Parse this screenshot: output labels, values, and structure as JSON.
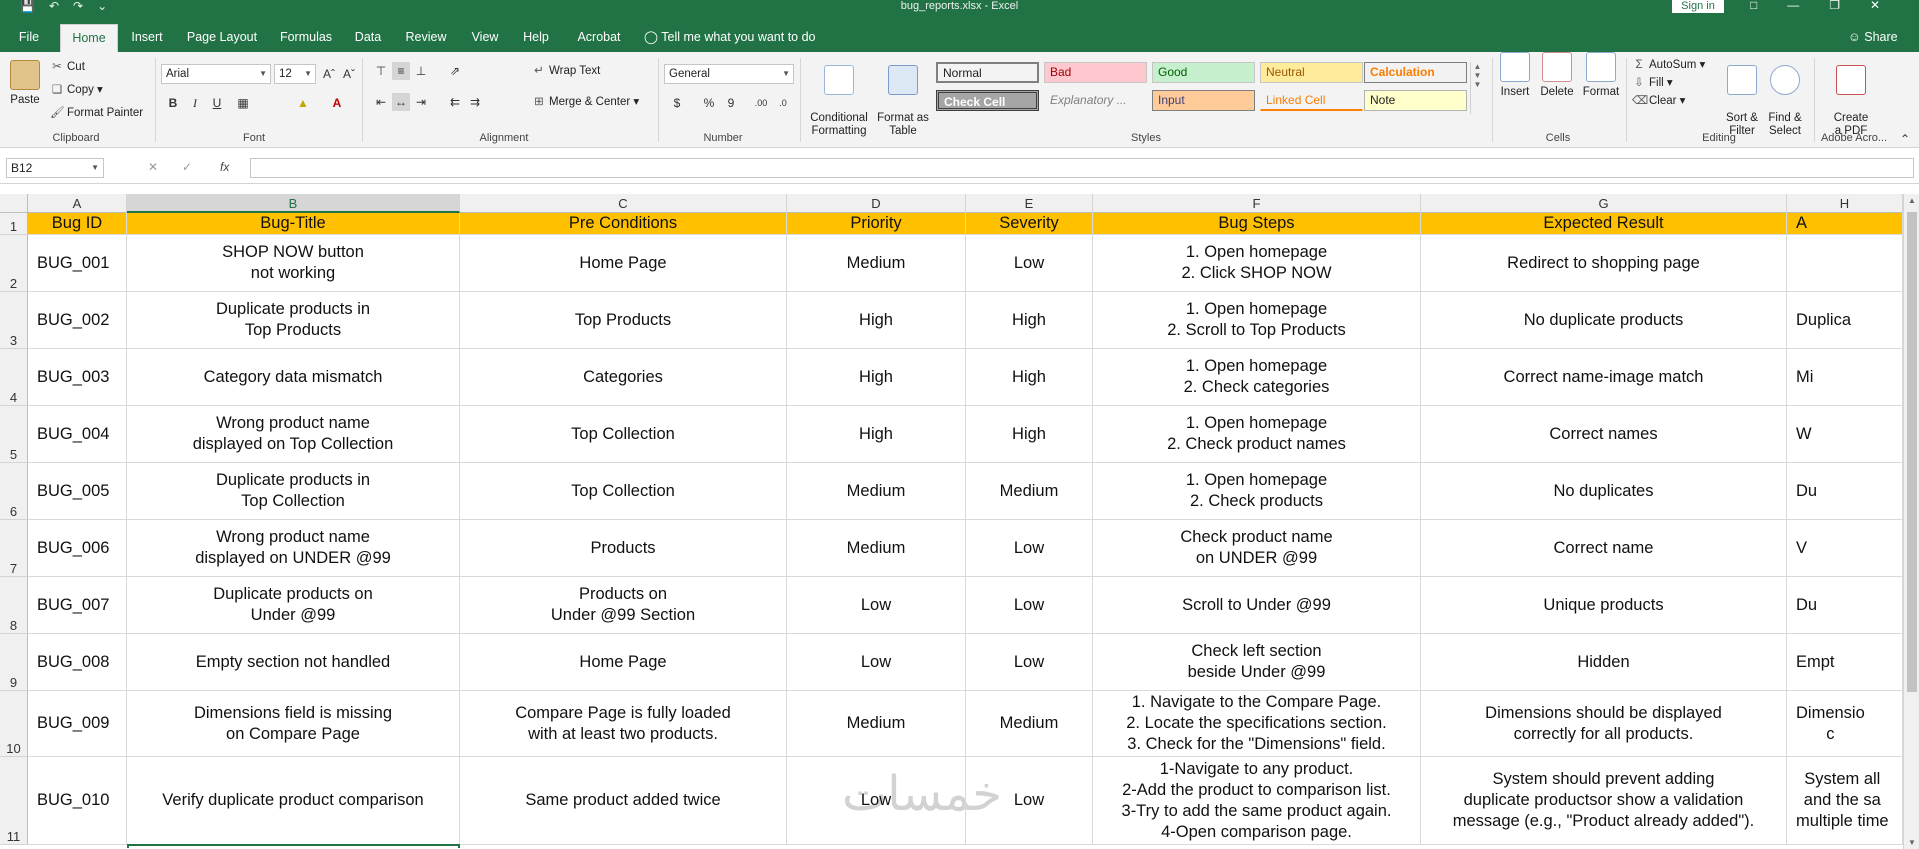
{
  "window": {
    "title": "bug_reports.xlsx  -  Excel",
    "sign_in": "Sign in"
  },
  "tabs": [
    {
      "label": "File"
    },
    {
      "label": "Home"
    },
    {
      "label": "Insert"
    },
    {
      "label": "Page Layout"
    },
    {
      "label": "Formulas"
    },
    {
      "label": "Data"
    },
    {
      "label": "Review"
    },
    {
      "label": "View"
    },
    {
      "label": "Help"
    },
    {
      "label": "Acrobat"
    }
  ],
  "tell_me": "Tell me what you want to do",
  "share": "Share",
  "ribbon": {
    "clipboard": {
      "label": "Clipboard",
      "paste": "Paste",
      "cut": "Cut",
      "copy": "Copy",
      "format_painter": "Format Painter"
    },
    "font": {
      "label": "Font",
      "name": "Arial",
      "size": "12",
      "bold": "B",
      "italic": "I",
      "underline": "U"
    },
    "alignment": {
      "label": "Alignment",
      "wrap": "Wrap Text",
      "merge": "Merge & Center"
    },
    "number": {
      "label": "Number",
      "format": "General",
      "currency": "$",
      "percent": "%",
      "comma": "9"
    },
    "styles": {
      "label": "Styles",
      "conditional": "Conditional\nFormatting",
      "format_table": "Format as\nTable",
      "items": [
        {
          "name": "Normal",
          "bg": "#ffffff",
          "fg": "#000000"
        },
        {
          "name": "Bad",
          "bg": "#ffc7ce",
          "fg": "#9c0006"
        },
        {
          "name": "Good",
          "bg": "#c6efce",
          "fg": "#006100"
        },
        {
          "name": "Neutral",
          "bg": "#ffeb9c",
          "fg": "#9c5700"
        },
        {
          "name": "Calculation",
          "bg": "#f2f2f2",
          "fg": "#fa7d00"
        },
        {
          "name": "Check Cell",
          "bg": "#a5a5a5",
          "fg": "#ffffff"
        },
        {
          "name": "Explanatory ...",
          "bg": "#ffffff",
          "fg": "#7f7f7f"
        },
        {
          "name": "Input",
          "bg": "#ffcc99",
          "fg": "#3f3f76"
        },
        {
          "name": "Linked Cell",
          "bg": "#ffffff",
          "fg": "#fa7d00"
        },
        {
          "name": "Note",
          "bg": "#ffffcc",
          "fg": "#000000"
        }
      ]
    },
    "cells": {
      "label": "Cells",
      "insert": "Insert",
      "delete": "Delete",
      "format": "Format"
    },
    "editing": {
      "label": "Editing",
      "autosum": "AutoSum",
      "fill": "Fill",
      "clear": "Clear",
      "sort": "Sort &\nFilter",
      "find": "Find &\nSelect"
    },
    "acrobat": {
      "label": "Adobe Acro...",
      "create": "Create\na PDF"
    }
  },
  "formula_bar": {
    "name_box": "B12",
    "value": ""
  },
  "columns": [
    "A",
    "B",
    "C",
    "D",
    "E",
    "F",
    "G",
    "H"
  ],
  "selected_column": "B",
  "rows": [
    "1",
    "2",
    "3",
    "4",
    "5",
    "6",
    "7",
    "8",
    "9",
    "10",
    "11"
  ],
  "table": {
    "headers": [
      "Bug ID",
      "Bug-Title",
      "Pre Conditions",
      "Priority",
      "Severity",
      "Bug Steps",
      "Expected Result",
      "A"
    ],
    "data": [
      [
        "BUG_001",
        "SHOP NOW button\nnot working",
        "Home Page",
        "Medium",
        "Low",
        "1. Open homepage\n2. Click SHOP NOW",
        "Redirect to shopping page",
        ""
      ],
      [
        "BUG_002",
        "Duplicate products in\nTop Products",
        "Top Products",
        "High",
        "High",
        "1. Open homepage\n2. Scroll to Top Products",
        "No duplicate products",
        "Duplica"
      ],
      [
        "BUG_003",
        "Category data mismatch",
        "Categories",
        "High",
        "High",
        "1. Open homepage\n2. Check categories",
        "Correct name-image match",
        "Mi"
      ],
      [
        "BUG_004",
        "Wrong product name\ndisplayed on  Top Collection",
        "Top Collection",
        "High",
        "High",
        "1. Open homepage\n2. Check product names",
        "Correct names",
        "W"
      ],
      [
        "BUG_005",
        "Duplicate products in\nTop Collection",
        "Top Collection",
        "Medium",
        "Medium",
        "1. Open homepage\n2. Check products",
        "No duplicates",
        "Du"
      ],
      [
        "BUG_006",
        "Wrong product name\ndisplayed on UNDER @99",
        "Products",
        "Medium",
        "Low",
        "Check product name\non UNDER @99",
        "Correct name",
        "V"
      ],
      [
        "BUG_007",
        "Duplicate products on\nUnder @99",
        "Products on\nUnder @99 Section",
        "Low",
        "Low",
        "Scroll to Under @99",
        "Unique products",
        "Du"
      ],
      [
        "BUG_008",
        "Empty section not handled",
        "Home Page",
        "Low",
        "Low",
        "Check left section\nbeside Under @99",
        "Hidden",
        "Empt"
      ],
      [
        "BUG_009",
        "Dimensions field is missing\non Compare Page",
        "Compare Page is fully loaded\nwith at least two products.",
        "Medium",
        "Medium",
        "1. Navigate to the Compare Page.\n2. Locate the specifications section.\n3. Check for the \"Dimensions\" field.",
        "Dimensions should be displayed\ncorrectly for all products.",
        "Dimensio\nc"
      ],
      [
        "BUG_010",
        "Verify duplicate product comparison",
        "Same product added twice",
        "Low",
        "Low",
        "1-Navigate to any product.\n2-Add the product to comparison list.\n3-Try to add the same product again.\n4-Open comparison page.",
        "System should prevent adding\nduplicate productsor show a validation\nmessage (e.g., \"Product already added\").",
        "System all\nand the sa\nmultiple time"
      ]
    ]
  },
  "watermark": "خمسات"
}
